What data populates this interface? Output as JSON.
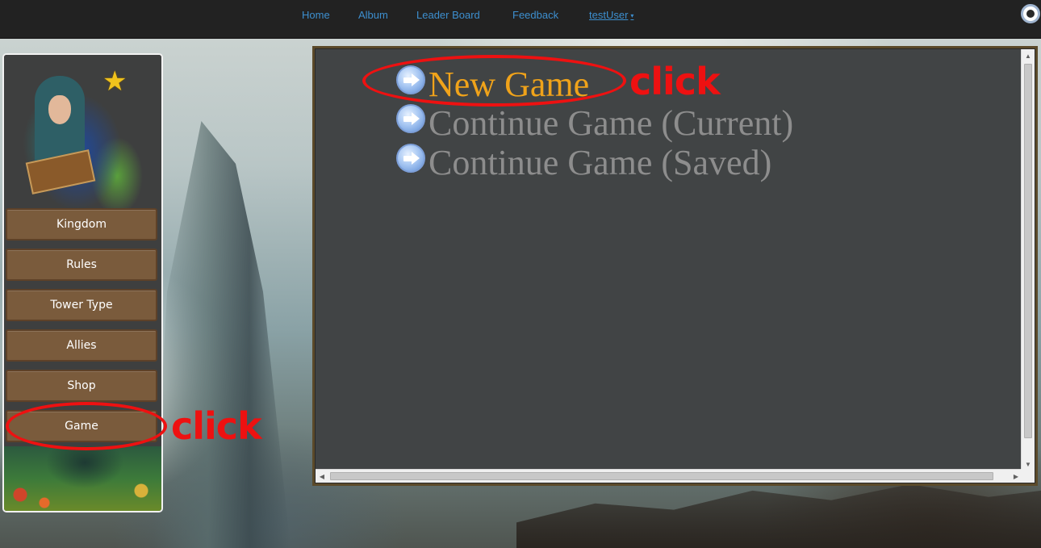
{
  "nav": {
    "links": [
      "Home",
      "Album",
      "Leader Board",
      "Feedback"
    ],
    "user": "testUser",
    "user_caret": "▾"
  },
  "sidebar": {
    "items": [
      "Kingdom",
      "Rules",
      "Tower Type",
      "Allies",
      "Shop",
      "Game"
    ],
    "star_icon": "★"
  },
  "main": {
    "options": [
      "New Game",
      "Continue Game (Current)",
      "Continue Game (Saved)"
    ],
    "highlight_color": "#f0a31a",
    "muted_color": "#8d8d8d"
  },
  "annotations": {
    "game_click": "click",
    "new_game_click": "click",
    "color": "#ee1111"
  },
  "scrollbars": {
    "up": "▲",
    "down": "▼",
    "left": "◀",
    "right": "▶"
  }
}
